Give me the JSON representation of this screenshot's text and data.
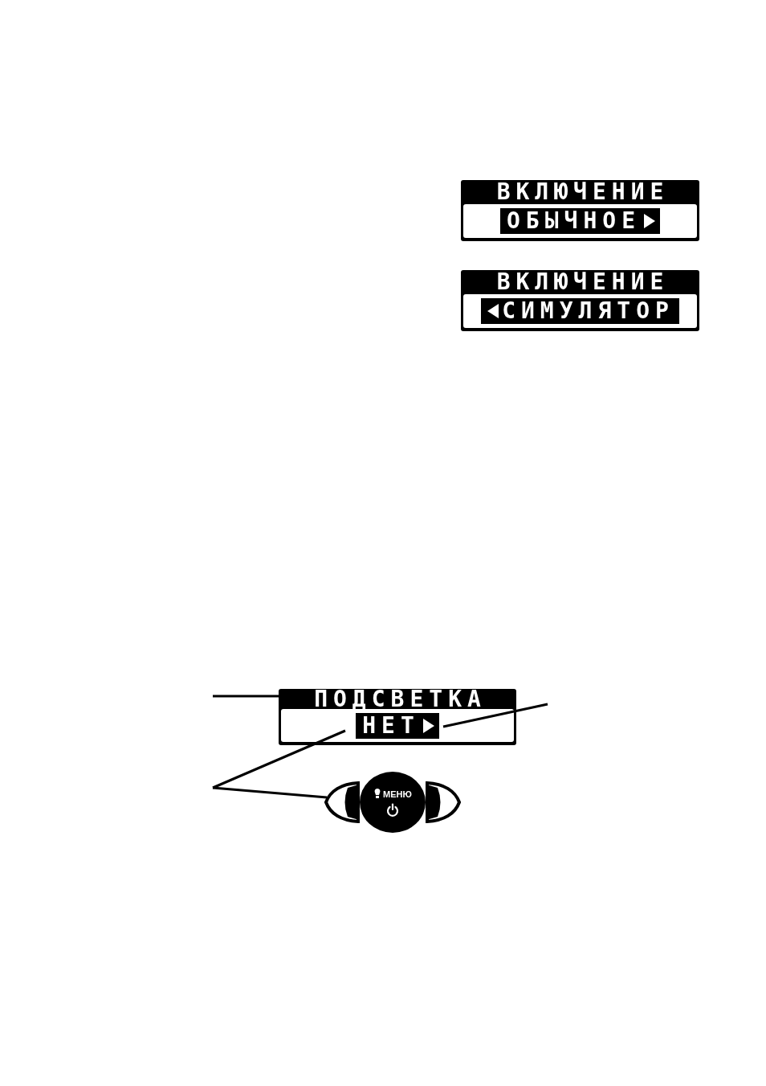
{
  "screens": [
    {
      "title": "ВКЛЮЧЕНИЕ",
      "value": "ОБЫЧНОЕ",
      "prev_arrow": false,
      "next_arrow": true
    },
    {
      "title": "ВКЛЮЧЕНИЕ",
      "value": "СИМУЛЯТОР",
      "prev_arrow": true,
      "next_arrow": false
    }
  ],
  "backlight_figure": {
    "screen": {
      "title": "ПОДСВЕТКА",
      "value": "НЕТ",
      "prev_arrow": false,
      "next_arrow": true
    },
    "keypad": {
      "menu_key": {
        "label": "МЕНЮ"
      }
    }
  }
}
